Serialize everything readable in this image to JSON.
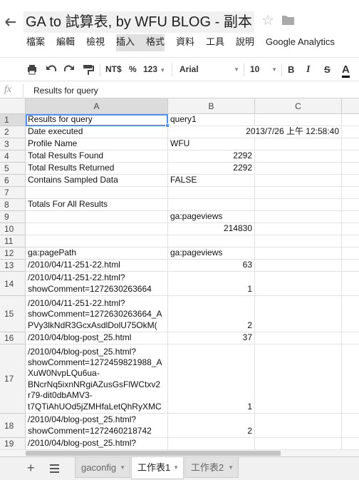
{
  "title": {
    "doc_title": "GA to 試算表, by WFU BLOG - 副本"
  },
  "menu": [
    {
      "label": "檔案",
      "name": "menu-file"
    },
    {
      "label": "編輯",
      "name": "menu-edit"
    },
    {
      "label": "檢視",
      "name": "menu-view"
    },
    {
      "label": "插入",
      "name": "menu-insert"
    },
    {
      "label": "格式",
      "name": "menu-format"
    },
    {
      "label": "資料",
      "name": "menu-data"
    },
    {
      "label": "工具",
      "name": "menu-tools"
    },
    {
      "label": "說明",
      "name": "menu-help"
    },
    {
      "label": "Google Analytics",
      "name": "menu-google-analytics"
    }
  ],
  "toolbar": {
    "currency": "NT$",
    "percent": "%",
    "number_format": "123",
    "font": "Arial",
    "font_size": "10",
    "bold": "B",
    "italic": "I",
    "strike": "S",
    "text_color": "A"
  },
  "formula_bar": {
    "fx": "fx",
    "content": "Results for query"
  },
  "columns": [
    "A",
    "B",
    "C"
  ],
  "rows": [
    {
      "n": "1",
      "a": [
        "Results for query"
      ],
      "b": [
        "query1"
      ],
      "b_num": false
    },
    {
      "n": "2",
      "a": [
        "Date executed"
      ],
      "b": [
        "2013/7/26 上午 12:58:40"
      ],
      "b_num": true
    },
    {
      "n": "3",
      "a": [
        "Profile Name"
      ],
      "b": [
        "WFU"
      ],
      "b_num": false
    },
    {
      "n": "4",
      "a": [
        "Total Results Found"
      ],
      "b": [
        "2292"
      ],
      "b_num": true
    },
    {
      "n": "5",
      "a": [
        "Total Results Returned"
      ],
      "b": [
        "2292"
      ],
      "b_num": true
    },
    {
      "n": "6",
      "a": [
        "Contains Sampled Data"
      ],
      "b": [
        "FALSE"
      ],
      "b_num": false
    },
    {
      "n": "7",
      "a": [
        ""
      ],
      "b": [
        ""
      ],
      "b_num": false
    },
    {
      "n": "8",
      "a": [
        "Totals For All Results"
      ],
      "b": [
        ""
      ],
      "b_num": false
    },
    {
      "n": "9",
      "a": [
        ""
      ],
      "b": [
        "ga:pageviews"
      ],
      "b_num": false
    },
    {
      "n": "10",
      "a": [
        ""
      ],
      "b": [
        "214830"
      ],
      "b_num": true
    },
    {
      "n": "11",
      "a": [
        ""
      ],
      "b": [
        ""
      ],
      "b_num": false
    },
    {
      "n": "12",
      "a": [
        "ga:pagePath"
      ],
      "b": [
        "ga:pageviews"
      ],
      "b_num": false
    },
    {
      "n": "13",
      "a": [
        "/2010/04/11-251-22.html"
      ],
      "b": [
        "63"
      ],
      "b_num": true
    },
    {
      "n": "14",
      "a": [
        "/2010/04/11-251-22.html?",
        "showComment=1272630263664"
      ],
      "b": [
        "1"
      ],
      "b_num": true
    },
    {
      "n": "15",
      "a": [
        "/2010/04/11-251-22.html?",
        "showComment=1272630263664_A",
        "PVy3lkNdR3GcxAsdlDolU75OkM("
      ],
      "b": [
        "2"
      ],
      "b_num": true
    },
    {
      "n": "16",
      "a": [
        "/2010/04/blog-post_25.html"
      ],
      "b": [
        "37"
      ],
      "b_num": true
    },
    {
      "n": "17",
      "a": [
        "/2010/04/blog-post_25.html?",
        "showComment=1272459821988_A",
        "XuW0NvpLQu6ua-",
        "BNcrNq5ixnNRgiAZusGsFlWCtxv2",
        "r79-dit0dbAMV3-",
        "t7QTiAhUOd5jZMHfaLetQhRyXMC"
      ],
      "b": [
        "1"
      ],
      "b_num": true
    },
    {
      "n": "18",
      "a": [
        "/2010/04/blog-post_25.html?",
        "showComment=1272460218742"
      ],
      "b": [
        "2"
      ],
      "b_num": true
    },
    {
      "n": "19",
      "a": [
        "/2010/04/blog-post_25.html?"
      ],
      "b": [
        ""
      ],
      "b_num": false
    }
  ],
  "sheets": [
    {
      "label": "gaconfig",
      "active": false
    },
    {
      "label": "工作表1",
      "active": true
    },
    {
      "label": "工作表2",
      "active": false
    }
  ],
  "colors": {
    "selection": "#4d90fe",
    "header_bg": "#f3f3f3"
  }
}
